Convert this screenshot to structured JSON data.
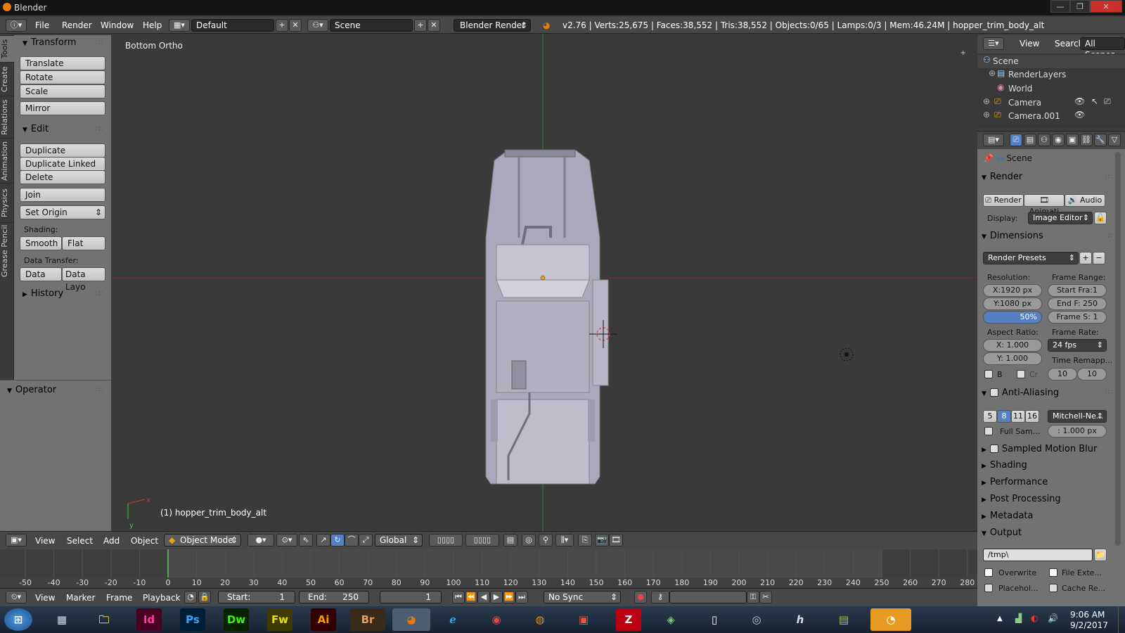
{
  "window": {
    "title": "Blender",
    "min": "—",
    "max": "❐",
    "close": "✕"
  },
  "info": {
    "menus": [
      "File",
      "Render",
      "Window",
      "Help"
    ],
    "screen_layout": "Default",
    "scene": "Scene",
    "engine": "Blender Render",
    "stats": "v2.76 | Verts:25,675 | Faces:38,552 | Tris:38,552 | Objects:0/65 | Lamps:0/3 | Mem:46.24M | hopper_trim_body_alt"
  },
  "toolshelf": {
    "tabs": [
      "Tools",
      "Create",
      "Relations",
      "Animation",
      "Physics",
      "Grease Pencil"
    ],
    "transform": {
      "title": "Transform",
      "buttons": [
        "Translate",
        "Rotate",
        "Scale",
        "Mirror"
      ]
    },
    "edit": {
      "title": "Edit",
      "buttons": [
        "Duplicate",
        "Duplicate Linked",
        "Delete",
        "Join",
        "Set Origin"
      ],
      "shading_label": "Shading:",
      "smooth": "Smooth",
      "flat": "Flat",
      "data_transfer_label": "Data Transfer:",
      "data": "Data",
      "data_layo": "Data Layo"
    },
    "history": "History"
  },
  "operator": {
    "title": "Operator"
  },
  "viewport": {
    "view_label": "Bottom Ortho",
    "object_label": "(1) hopper_trim_body_alt"
  },
  "vpheader": {
    "menus": [
      "View",
      "Select",
      "Add",
      "Object"
    ],
    "mode": "Object Mode",
    "orientation": "Global"
  },
  "timeline": {
    "ticks": [
      "-50",
      "-40",
      "-30",
      "-20",
      "-10",
      "0",
      "10",
      "20",
      "30",
      "40",
      "50",
      "60",
      "70",
      "80",
      "90",
      "100",
      "110",
      "120",
      "130",
      "140",
      "150",
      "160",
      "170",
      "180",
      "190",
      "200",
      "210",
      "220",
      "230",
      "240",
      "250",
      "260",
      "270",
      "280"
    ],
    "menus": [
      "View",
      "Marker",
      "Frame",
      "Playback"
    ],
    "start_label": "Start:",
    "start": "1",
    "end_label": "End:",
    "end": "250",
    "current": "1",
    "sync": "No Sync"
  },
  "outliner": {
    "menus": [
      "View",
      "Search"
    ],
    "filter": "All Scenes",
    "rows": [
      "Scene",
      "RenderLayers",
      "World",
      "Camera",
      "Camera.001"
    ]
  },
  "properties": {
    "context": "Scene",
    "render": {
      "title": "Render",
      "render_btn": "Render",
      "anim_btn": "Animati",
      "audio_btn": "Audio",
      "display_label": "Display:",
      "display": "Image Editor"
    },
    "dimensions": {
      "title": "Dimensions",
      "presets": "Render Presets",
      "resolution_label": "Resolution:",
      "res_x": "X:1920 px",
      "res_y": "Y:1080 px",
      "res_pct": "50%",
      "frame_range_label": "Frame Range:",
      "start_frame": "Start Fra:1",
      "end_frame": "End F: 250",
      "frame_step": "Frame S: 1",
      "aspect_label": "Aspect Ratio:",
      "aspect_x": "X:   1.000",
      "aspect_y": "Y:   1.000",
      "frame_rate_label": "Frame Rate:",
      "fps": "24 fps",
      "time_remap": "Time Remapp...",
      "b": "B",
      "cr": "Cr",
      "old": "10",
      "new": "10"
    },
    "aa": {
      "title": "Anti-Aliasing",
      "samples": [
        "5",
        "8",
        "11",
        "16"
      ],
      "filter": "Mitchell-Ne...",
      "full_sample": "Full Sam...",
      "size": ": 1.000 px"
    },
    "collapsed": [
      "Sampled Motion Blur",
      "Shading",
      "Performance",
      "Post Processing",
      "Metadata"
    ],
    "output": {
      "title": "Output",
      "path": "/tmp\\",
      "overwrite": "Overwrite",
      "file_ext": "File Exte...",
      "placeholders": "Placehol...",
      "cache": "Cache Re..."
    }
  },
  "taskbar": {
    "apps": [
      "Id",
      "Ps",
      "Dw",
      "Fw",
      "Ai",
      "Br"
    ],
    "time": "9:06 AM",
    "date": "9/2/2017"
  },
  "colors": {
    "accent": "#5680c2",
    "blender_orange": "#e87d0d",
    "panel": "#727272",
    "viewport": "#3a3a3a"
  }
}
